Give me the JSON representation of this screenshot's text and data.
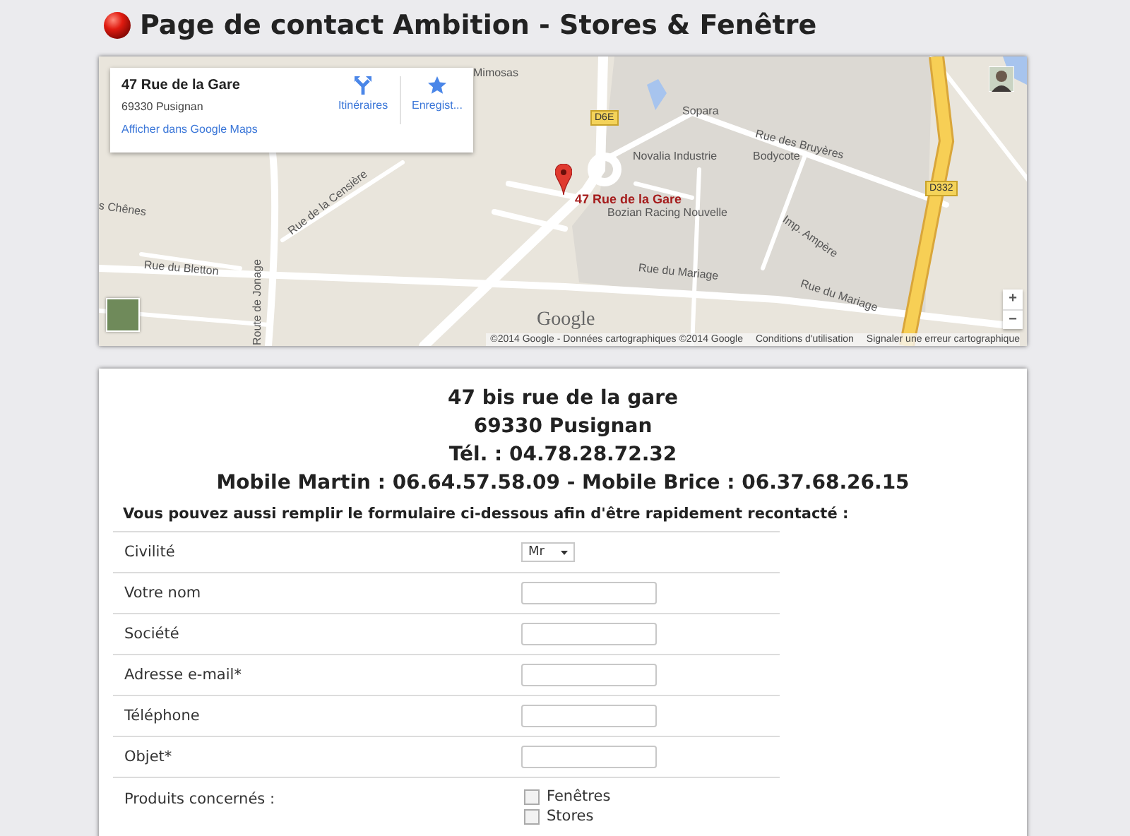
{
  "page": {
    "title": "Page de contact Ambition - Stores & Fenêtre"
  },
  "map": {
    "info_card": {
      "title": "47 Rue de la Gare",
      "address": "69330 Pusignan",
      "link": "Afficher dans Google Maps",
      "actions": [
        {
          "label": "Itinéraires",
          "kind": "directions"
        },
        {
          "label": "Enregist...",
          "kind": "save"
        }
      ]
    },
    "marker_label": "47 Rue de la Gare",
    "labels": [
      "Mimosas",
      "Sopara",
      "Rue des Bruyères",
      "Novalia Industrie",
      "Bodycote",
      "Bozian Racing Nouvelle",
      "Imp. Ampère",
      "s Chênes",
      "Route de Jonage",
      "Rue de la Censière",
      "Rue du Bletton",
      "Rue du Mariage",
      "Rue du Mariage"
    ],
    "road_shields": [
      "D6E",
      "D332"
    ],
    "zoom_in": "+",
    "zoom_out": "−",
    "logo": "Google",
    "footer": [
      "©2014 Google - Données cartographiques ©2014 Google",
      "Conditions d'utilisation",
      "Signaler une erreur cartographique"
    ]
  },
  "contact": {
    "lines": [
      "47 bis rue de la gare",
      "69330 Pusignan",
      "Tél. : 04.78.28.72.32",
      "Mobile Martin : 06.64.57.58.09 - Mobile Brice : 06.37.68.26.15"
    ],
    "intro": "Vous pouvez aussi remplir le formulaire ci-dessous afin d'être rapidement recontacté :"
  },
  "form": {
    "fields": [
      {
        "label": "Civilité",
        "kind": "select",
        "value": "Mr"
      },
      {
        "label": "Votre nom",
        "kind": "text"
      },
      {
        "label": "Société",
        "kind": "text"
      },
      {
        "label": "Adresse e-mail*",
        "kind": "text"
      },
      {
        "label": "Téléphone",
        "kind": "text"
      },
      {
        "label": "Objet*",
        "kind": "text"
      },
      {
        "label": "Produits concernés :",
        "kind": "checkboxes",
        "options": [
          {
            "label": "Fenêtres",
            "checked": false
          },
          {
            "label": "Stores",
            "checked": false
          }
        ]
      }
    ]
  }
}
